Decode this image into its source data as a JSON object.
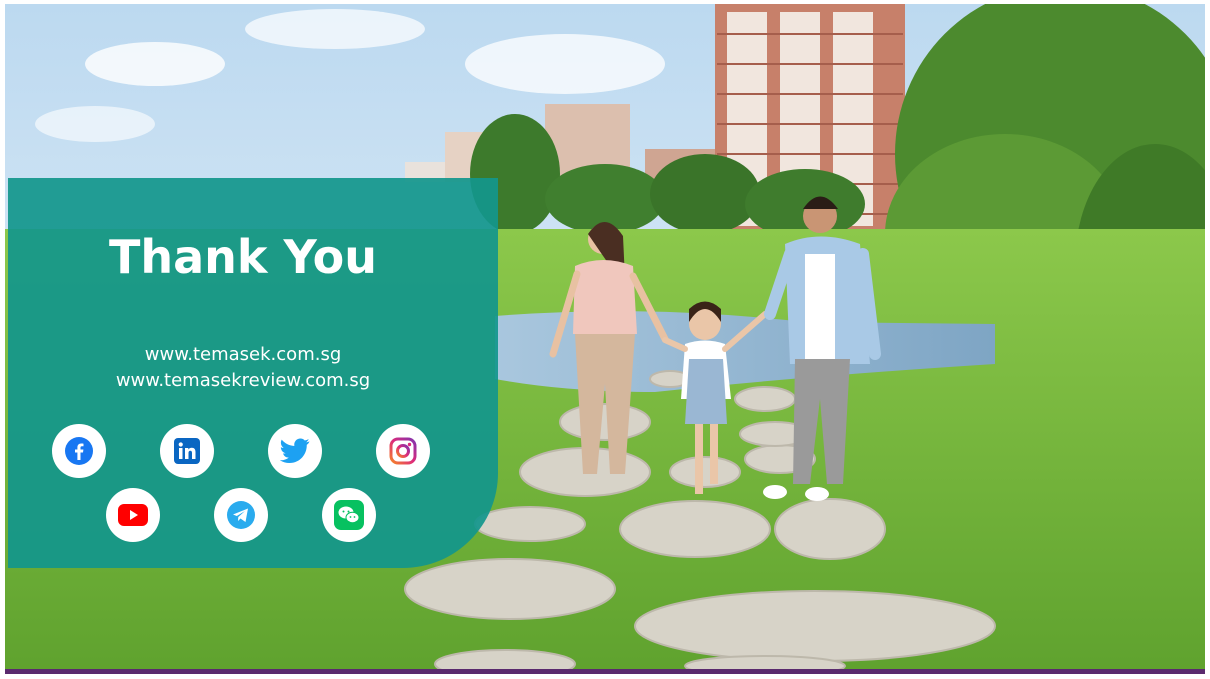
{
  "slide": {
    "title": "Thank You",
    "urls": [
      "www.temasek.com.sg",
      "www.temasekreview.com.sg"
    ],
    "social_links": [
      {
        "icon": "facebook-icon",
        "color": "#1877F2"
      },
      {
        "icon": "linkedin-icon",
        "color": "#0A66C2"
      },
      {
        "icon": "twitter-icon",
        "color": "#1DA1F2"
      },
      {
        "icon": "instagram-icon",
        "color": "#E1306C"
      },
      {
        "icon": "youtube-icon",
        "color": "#FF0000"
      },
      {
        "icon": "telegram-icon",
        "color": "#2AABEE"
      },
      {
        "icon": "wechat-icon",
        "color": "#07C160"
      }
    ]
  },
  "colors": {
    "panel": "#12968C",
    "bottom_bar": "#5A2A6E"
  }
}
